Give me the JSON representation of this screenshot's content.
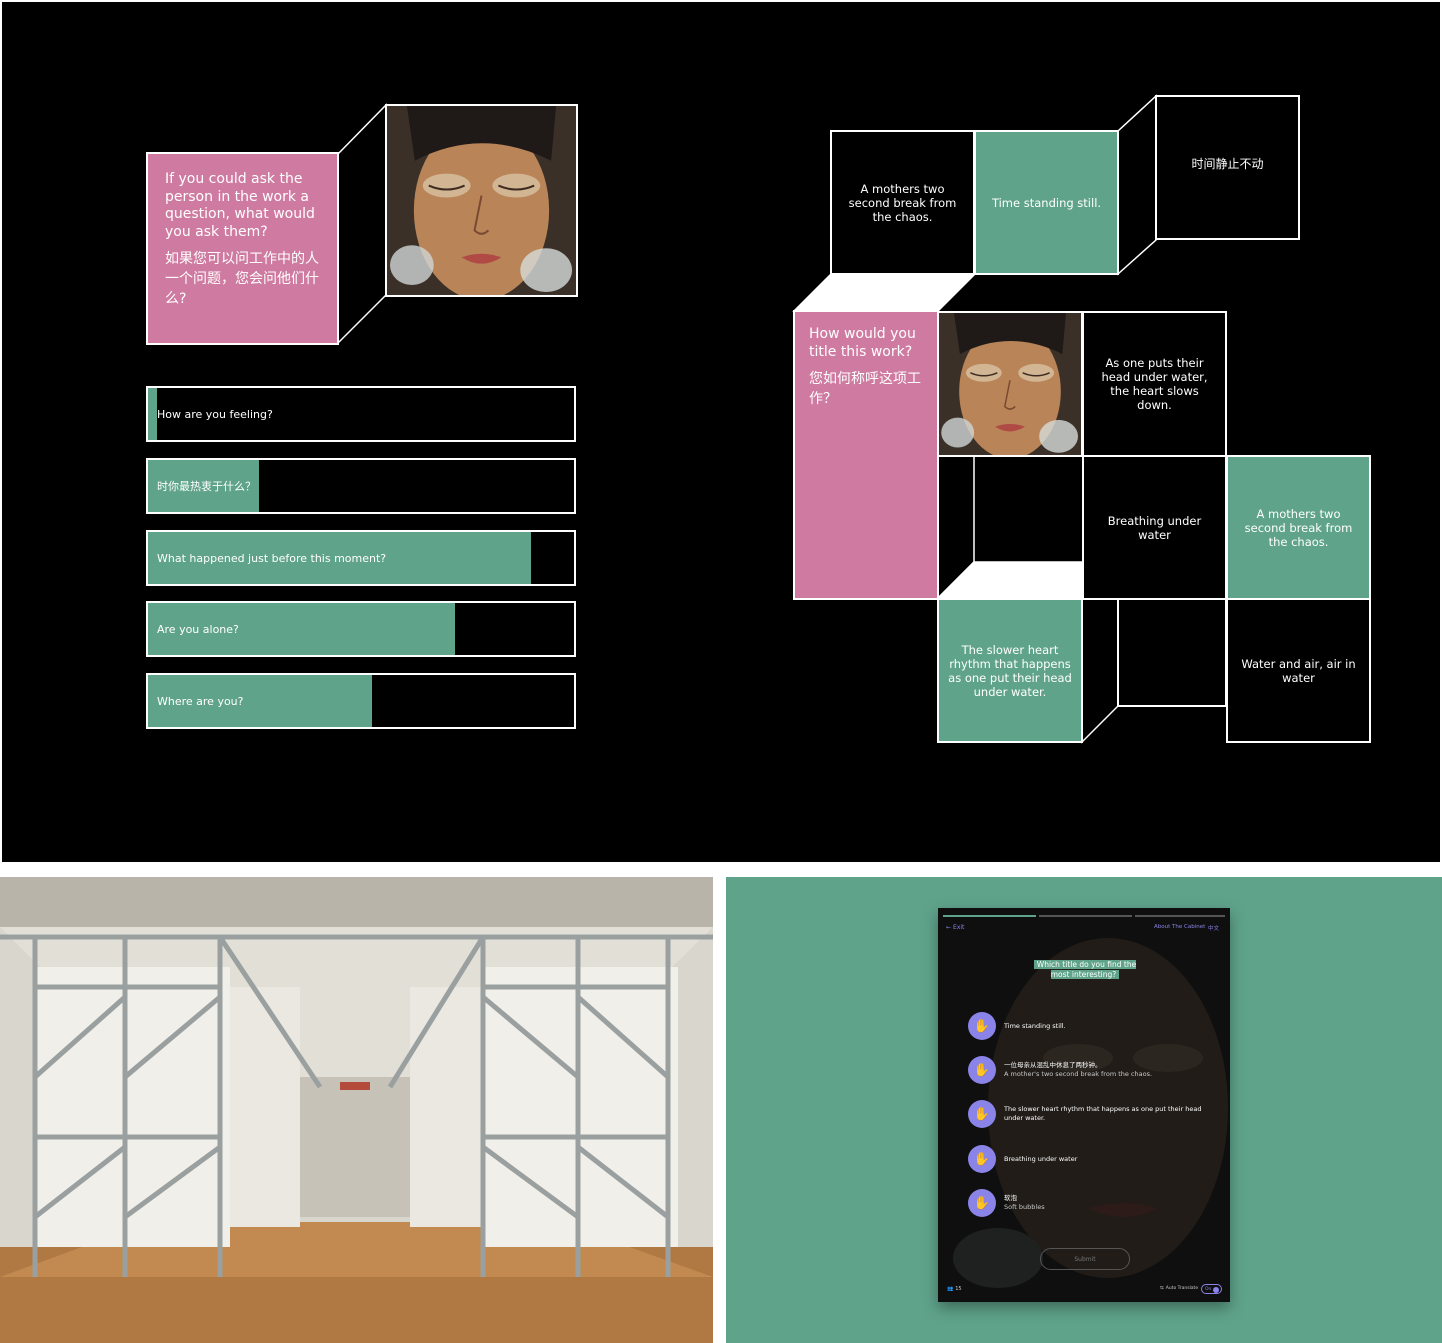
{
  "left_board": {
    "question_en": "If you could ask the person in the work a question, what would you ask them?",
    "question_cn": "如果您可以问工作中的人一个问题，您会问他们什么?",
    "poll_bars": [
      {
        "label": "How are you feeling?",
        "fill": 0.02
      },
      {
        "label": "时你最热衷于什么？",
        "fill": 0.26
      },
      {
        "label": "What happened just before this moment?",
        "fill": 0.9
      },
      {
        "label": "Are you alone?",
        "fill": 0.72
      },
      {
        "label": "Where are you?",
        "fill": 0.525
      }
    ]
  },
  "right_board": {
    "question_en": "How would you title this work?",
    "question_cn": "您如何称呼这项工作？",
    "tiles": {
      "mothers_top": "A mothers two second break from the chaos.",
      "time_standing": "Time standing still.",
      "time_cn": "时间静止不动",
      "one_puts_head": "As one puts their head under water, the heart slows down.",
      "breathing": "Breathing under water",
      "mothers_right": "A mothers two second break from the chaos.",
      "slower_heart": "The slower heart rhythm that happens as one put their head under water.",
      "water_air": "Water and air, air in water"
    }
  },
  "tablet": {
    "exit_label": "Exit",
    "about_label": "About The Cabinet",
    "lang_label": "中文",
    "question": "Which title do you find the most interesting?",
    "options": [
      {
        "primary": "Time standing still.",
        "secondary": ""
      },
      {
        "primary": "一位母亲从混乱中休息了两秒钟。",
        "secondary": "A mother's two second break from the chaos."
      },
      {
        "primary": "The slower heart rhythm that happens as one put their head under water.",
        "secondary": ""
      },
      {
        "primary": "Breathing under water",
        "secondary": ""
      },
      {
        "primary": "软泡",
        "secondary": "Soft bubbles"
      }
    ],
    "submit_label": "Submit",
    "user_count": "15",
    "auto_translate_label": "Auto Translate",
    "toggle_label": "On"
  },
  "colors": {
    "teal": "#5fa38b",
    "pink": "#cf7aa0",
    "accent": "#8a83e8"
  }
}
